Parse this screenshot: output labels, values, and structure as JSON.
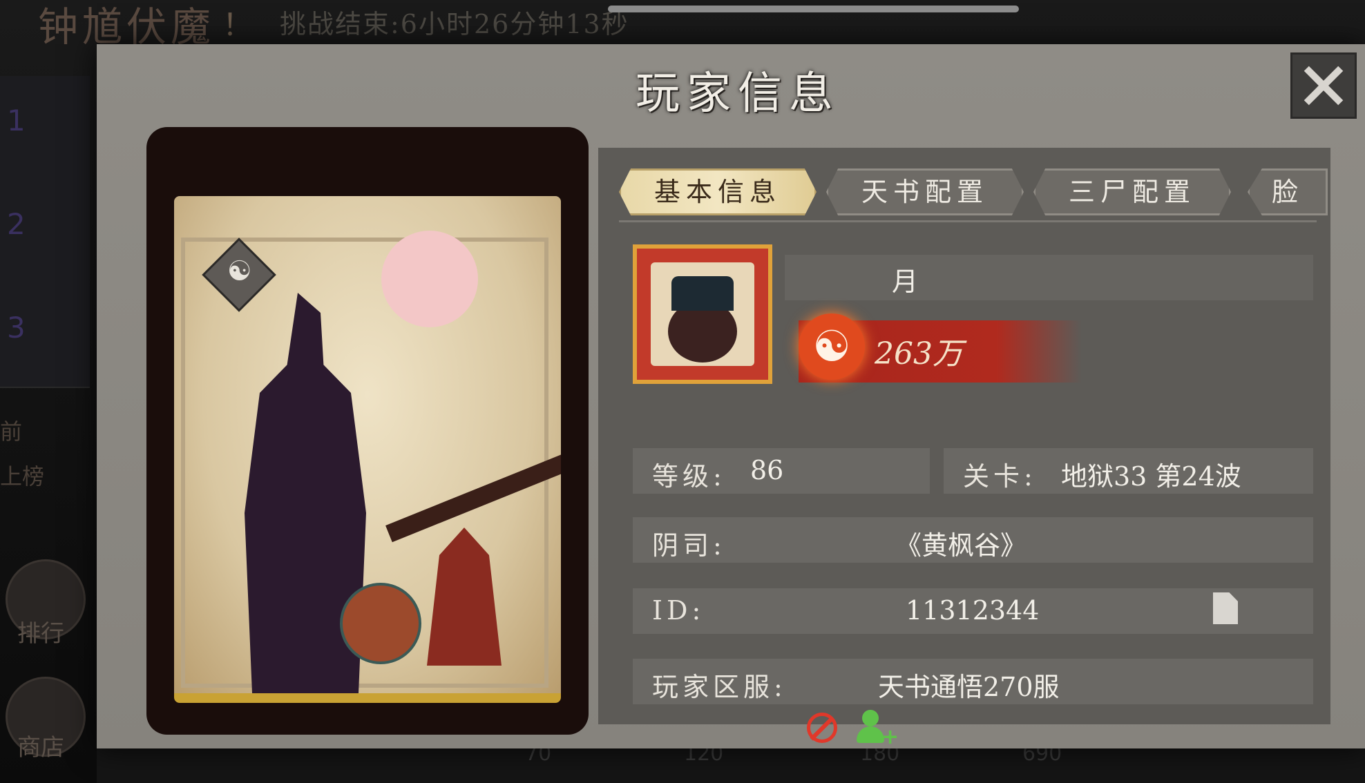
{
  "background": {
    "event_title": "钟馗伏魔",
    "event_exclaim": "！",
    "event_timer": "挑战结束:6小时26分钟13秒",
    "rail_ranks": [
      "1",
      "2",
      "3"
    ],
    "rail_texts": [
      "前",
      "上榜"
    ],
    "rail_buttons": [
      "排行",
      "商店"
    ],
    "bottom_numbers": [
      "70",
      "120",
      "180",
      "690"
    ]
  },
  "panel": {
    "title": "玩家信息",
    "tabs": [
      {
        "label": "基本信息",
        "active": true
      },
      {
        "label": "天书配置",
        "active": false
      },
      {
        "label": "三尸配置",
        "active": false
      },
      {
        "label": "脸",
        "active": false
      }
    ]
  },
  "player": {
    "name": "月",
    "power": "263万",
    "level_label": "等级:",
    "level": "86",
    "stage_label": "关卡:",
    "stage": "地狱33 第24波",
    "guild_label": "阴司:",
    "guild": "《黄枫谷》",
    "id_label": "ID:",
    "id": "11312344",
    "server_label": "玩家区服:",
    "server": "天书通悟270服"
  },
  "icons": {
    "close": "close-icon",
    "copy": "copy-icon",
    "block": "block-icon",
    "add_friend": "add-friend-icon",
    "yinyang": "yinyang-icon",
    "power": "yinyang-power-icon"
  },
  "colors": {
    "panel": "#8f8c86",
    "info_pane": "#5d5b57",
    "tab_active": "#f2e6c2",
    "power_red": "#b02a1e",
    "block_red": "#e0382a",
    "friend_green": "#5fc24a"
  }
}
